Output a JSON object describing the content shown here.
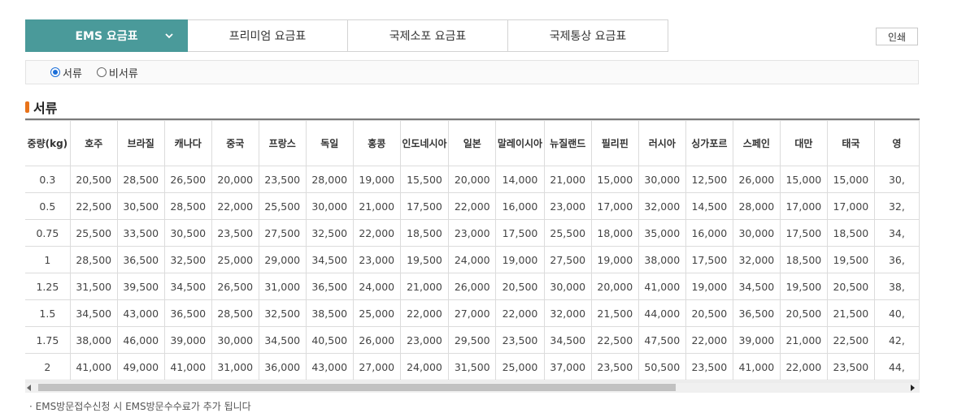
{
  "tabs": [
    {
      "label": "EMS 요금표",
      "active": true
    },
    {
      "label": "프리미엄 요금표"
    },
    {
      "label": "국제소포 요금표"
    },
    {
      "label": "국제통상 요금표"
    }
  ],
  "print_label": "인쇄",
  "radios": [
    {
      "label": "서류",
      "checked": true
    },
    {
      "label": "비서류",
      "checked": false
    }
  ],
  "section_title": "서류",
  "table": {
    "headers": [
      "중량(kg)",
      "호주",
      "브라질",
      "캐나다",
      "중국",
      "프랑스",
      "독일",
      "홍콩",
      "인도네시아",
      "일본",
      "말레이시아",
      "뉴질랜드",
      "필리핀",
      "러시아",
      "싱가포르",
      "스페인",
      "대만",
      "태국",
      "영"
    ],
    "rows": [
      [
        "0.3",
        "20,500",
        "28,500",
        "26,500",
        "20,000",
        "23,500",
        "28,000",
        "19,000",
        "15,500",
        "20,000",
        "14,000",
        "21,000",
        "15,000",
        "30,000",
        "12,500",
        "26,000",
        "15,000",
        "15,000",
        "30,"
      ],
      [
        "0.5",
        "22,500",
        "30,500",
        "28,500",
        "22,000",
        "25,500",
        "30,000",
        "21,000",
        "17,500",
        "22,000",
        "16,000",
        "23,000",
        "17,000",
        "32,000",
        "14,500",
        "28,000",
        "17,000",
        "17,000",
        "32,"
      ],
      [
        "0.75",
        "25,500",
        "33,500",
        "30,500",
        "23,500",
        "27,500",
        "32,500",
        "22,000",
        "18,500",
        "23,000",
        "17,500",
        "25,500",
        "18,000",
        "35,000",
        "16,000",
        "30,000",
        "17,500",
        "18,500",
        "34,"
      ],
      [
        "1",
        "28,500",
        "36,500",
        "32,500",
        "25,000",
        "29,000",
        "34,500",
        "23,000",
        "19,500",
        "24,000",
        "19,000",
        "27,500",
        "19,000",
        "38,000",
        "17,500",
        "32,000",
        "18,500",
        "19,500",
        "36,"
      ],
      [
        "1.25",
        "31,500",
        "39,500",
        "34,500",
        "26,500",
        "31,000",
        "36,500",
        "24,000",
        "21,000",
        "26,000",
        "20,500",
        "30,000",
        "20,000",
        "41,000",
        "19,000",
        "34,500",
        "19,500",
        "20,500",
        "38,"
      ],
      [
        "1.5",
        "34,500",
        "43,000",
        "36,500",
        "28,500",
        "32,500",
        "38,500",
        "25,000",
        "22,000",
        "27,000",
        "22,000",
        "32,000",
        "21,500",
        "44,000",
        "20,500",
        "36,500",
        "20,500",
        "21,500",
        "40,"
      ],
      [
        "1.75",
        "38,000",
        "46,000",
        "39,000",
        "30,000",
        "34,500",
        "40,500",
        "26,000",
        "23,000",
        "29,500",
        "23,500",
        "34,500",
        "22,500",
        "47,500",
        "22,000",
        "39,000",
        "21,000",
        "22,500",
        "42,"
      ],
      [
        "2",
        "41,000",
        "49,000",
        "41,000",
        "31,000",
        "36,000",
        "43,000",
        "27,000",
        "24,000",
        "31,500",
        "25,000",
        "37,000",
        "23,500",
        "50,500",
        "23,500",
        "41,000",
        "22,000",
        "23,500",
        "44,"
      ]
    ]
  },
  "note": "· EMS방문접수신청 시 EMS방문수수료가 추가 됩니다",
  "colors": {
    "accent": "#4a9a9a",
    "section_marker": "#e8731a",
    "radio": "#1a6ed8"
  }
}
